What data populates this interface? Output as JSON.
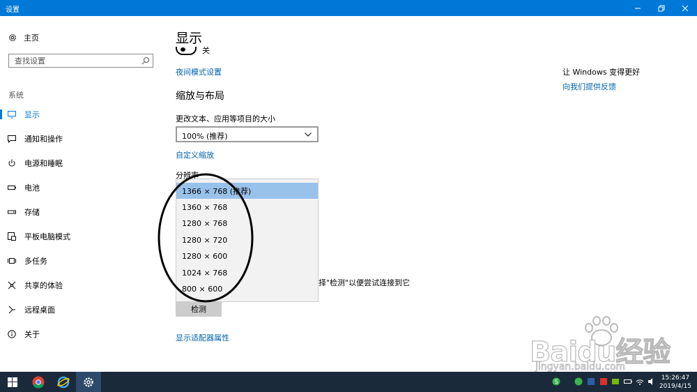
{
  "window": {
    "title": "设置"
  },
  "sidebar": {
    "home_label": "主页",
    "search_placeholder": "查找设置",
    "section_label": "系统",
    "items": [
      {
        "label": "显示",
        "icon": "monitor-icon",
        "active": true
      },
      {
        "label": "通知和操作",
        "icon": "notification-icon"
      },
      {
        "label": "电源和睡眠",
        "icon": "power-icon"
      },
      {
        "label": "电池",
        "icon": "battery-icon"
      },
      {
        "label": "存储",
        "icon": "storage-icon"
      },
      {
        "label": "平板电脑模式",
        "icon": "tablet-mode-icon"
      },
      {
        "label": "多任务",
        "icon": "multitasking-icon"
      },
      {
        "label": "共享的体验",
        "icon": "shared-experience-icon"
      },
      {
        "label": "远程桌面",
        "icon": "remote-desktop-icon"
      },
      {
        "label": "关于",
        "icon": "info-icon"
      }
    ]
  },
  "main": {
    "title": "显示",
    "night_light_state": "关",
    "night_light_settings_link": "夜间模式设置",
    "scale_heading": "缩放与布局",
    "scale_label": "更改文本、应用等项目的大小",
    "scale_value": "100% (推荐)",
    "custom_scaling_link": "自定义缩放",
    "resolution_label": "分辨率",
    "resolutions": [
      {
        "label": "1366 × 768 (推荐)",
        "selected": true
      },
      {
        "label": "1360 × 768"
      },
      {
        "label": "1280 × 768"
      },
      {
        "label": "1280 × 720"
      },
      {
        "label": "1280 × 600"
      },
      {
        "label": "1024 × 768"
      },
      {
        "label": "800 × 600"
      }
    ],
    "detect_hint": "择\"检测\"以便尝试连接到它",
    "detect_button": "检测",
    "adapter_properties_link": "显示适配器属性"
  },
  "feedback": {
    "title": "让 Windows 变得更好",
    "link": "向我们提供反馈"
  },
  "watermark": {
    "text": "Baidu经验",
    "url": "jingyan.baidu.com"
  },
  "taskbar": {
    "time": "15:26:47",
    "date": "2019/4/15"
  },
  "colors": {
    "accent": "#0078d7",
    "selection": "#99c2ea",
    "taskbar": "#1a2a3a"
  }
}
